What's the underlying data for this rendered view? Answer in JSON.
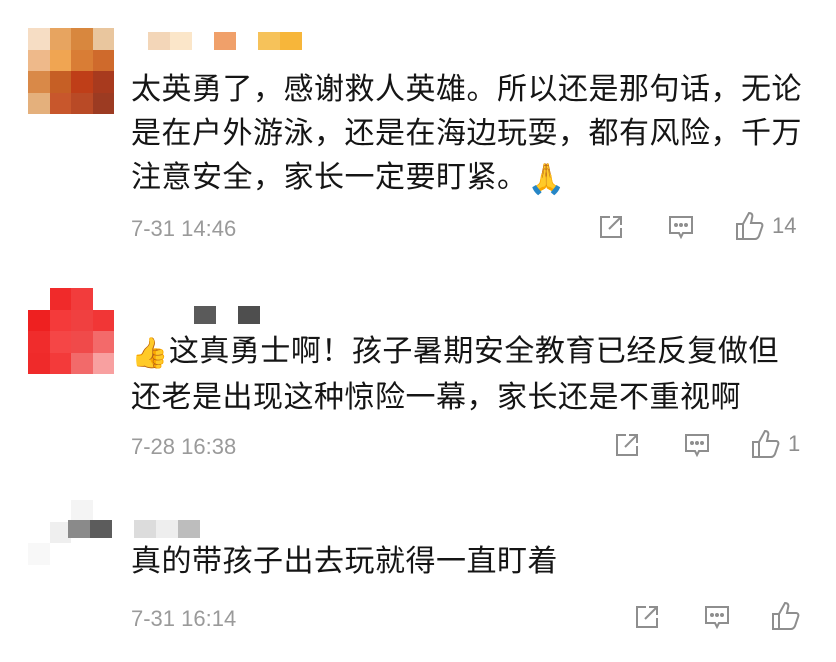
{
  "comments": [
    {
      "text": "太英勇了，感谢救人英雄。所以还是那句话，无论是在户外游泳，还是在海边玩耍，都有风险，千万注意安全，家长一定要盯紧。",
      "emoji": "🙏",
      "time": "7-31 14:46",
      "likes": "14",
      "avatar_colors": [
        "#f6ddc4",
        "#e7a460",
        "#d8873e",
        "#e9c69e",
        "#eeb98a",
        "#f0a552",
        "#d97d35",
        "#cf6a2c",
        "#d98948",
        "#c65f25",
        "#bf3e18",
        "#a83a1e",
        "#e4b07c",
        "#c8572c",
        "#b94a26",
        "#9c3b22"
      ],
      "name_colors": [
        "#f3d6b8",
        "#fbe6c9",
        "#ffffff",
        "#f0a06a",
        "#ffffff",
        "#f6c25a",
        "#f7b63a"
      ]
    },
    {
      "text": "这真勇士啊！孩子暑期安全教育已经反复做但还老是出现这种惊险一幕，家长还是不重视啊",
      "emoji": "👍",
      "time": "7-28 16:38",
      "likes": "1",
      "avatar_colors": [
        "#ffffff",
        "#f02a2a",
        "#f23c3c",
        "#ffffff",
        "#ee2020",
        "#f43a3a",
        "#f04040",
        "#f13636",
        "#f02c2c",
        "#f54646",
        "#f04a4a",
        "#f36a6a",
        "#ef2a2a",
        "#f33a3a",
        "#f26a6a",
        "#f8a0a0"
      ],
      "name_colors": [
        "#ffffff",
        "#5a5a5a",
        "#ffffff",
        "#4e4e4e"
      ]
    },
    {
      "text": "真的带孩子出去玩就得一直盯着",
      "emoji": "",
      "time": "7-31 16:14",
      "likes": "",
      "avatar_colors": [
        "#ffffff",
        "#ffffff",
        "#f4f4f4",
        "#ffffff",
        "#ffffff",
        "#efefef",
        "#ffffff",
        "#ffffff",
        "#f8f8f8",
        "#ffffff",
        "#ffffff",
        "#ffffff",
        "#ffffff",
        "#ffffff",
        "#ffffff",
        "#ffffff"
      ],
      "name_colors": [
        "#8a8a8a",
        "#5c5c5c",
        "#ffffff",
        "#dcdcdc",
        "#eeeeee",
        "#bdbdbd"
      ]
    }
  ],
  "icons": {
    "share": "share-icon",
    "reply": "comment-icon",
    "like": "thumbs-up-icon"
  }
}
